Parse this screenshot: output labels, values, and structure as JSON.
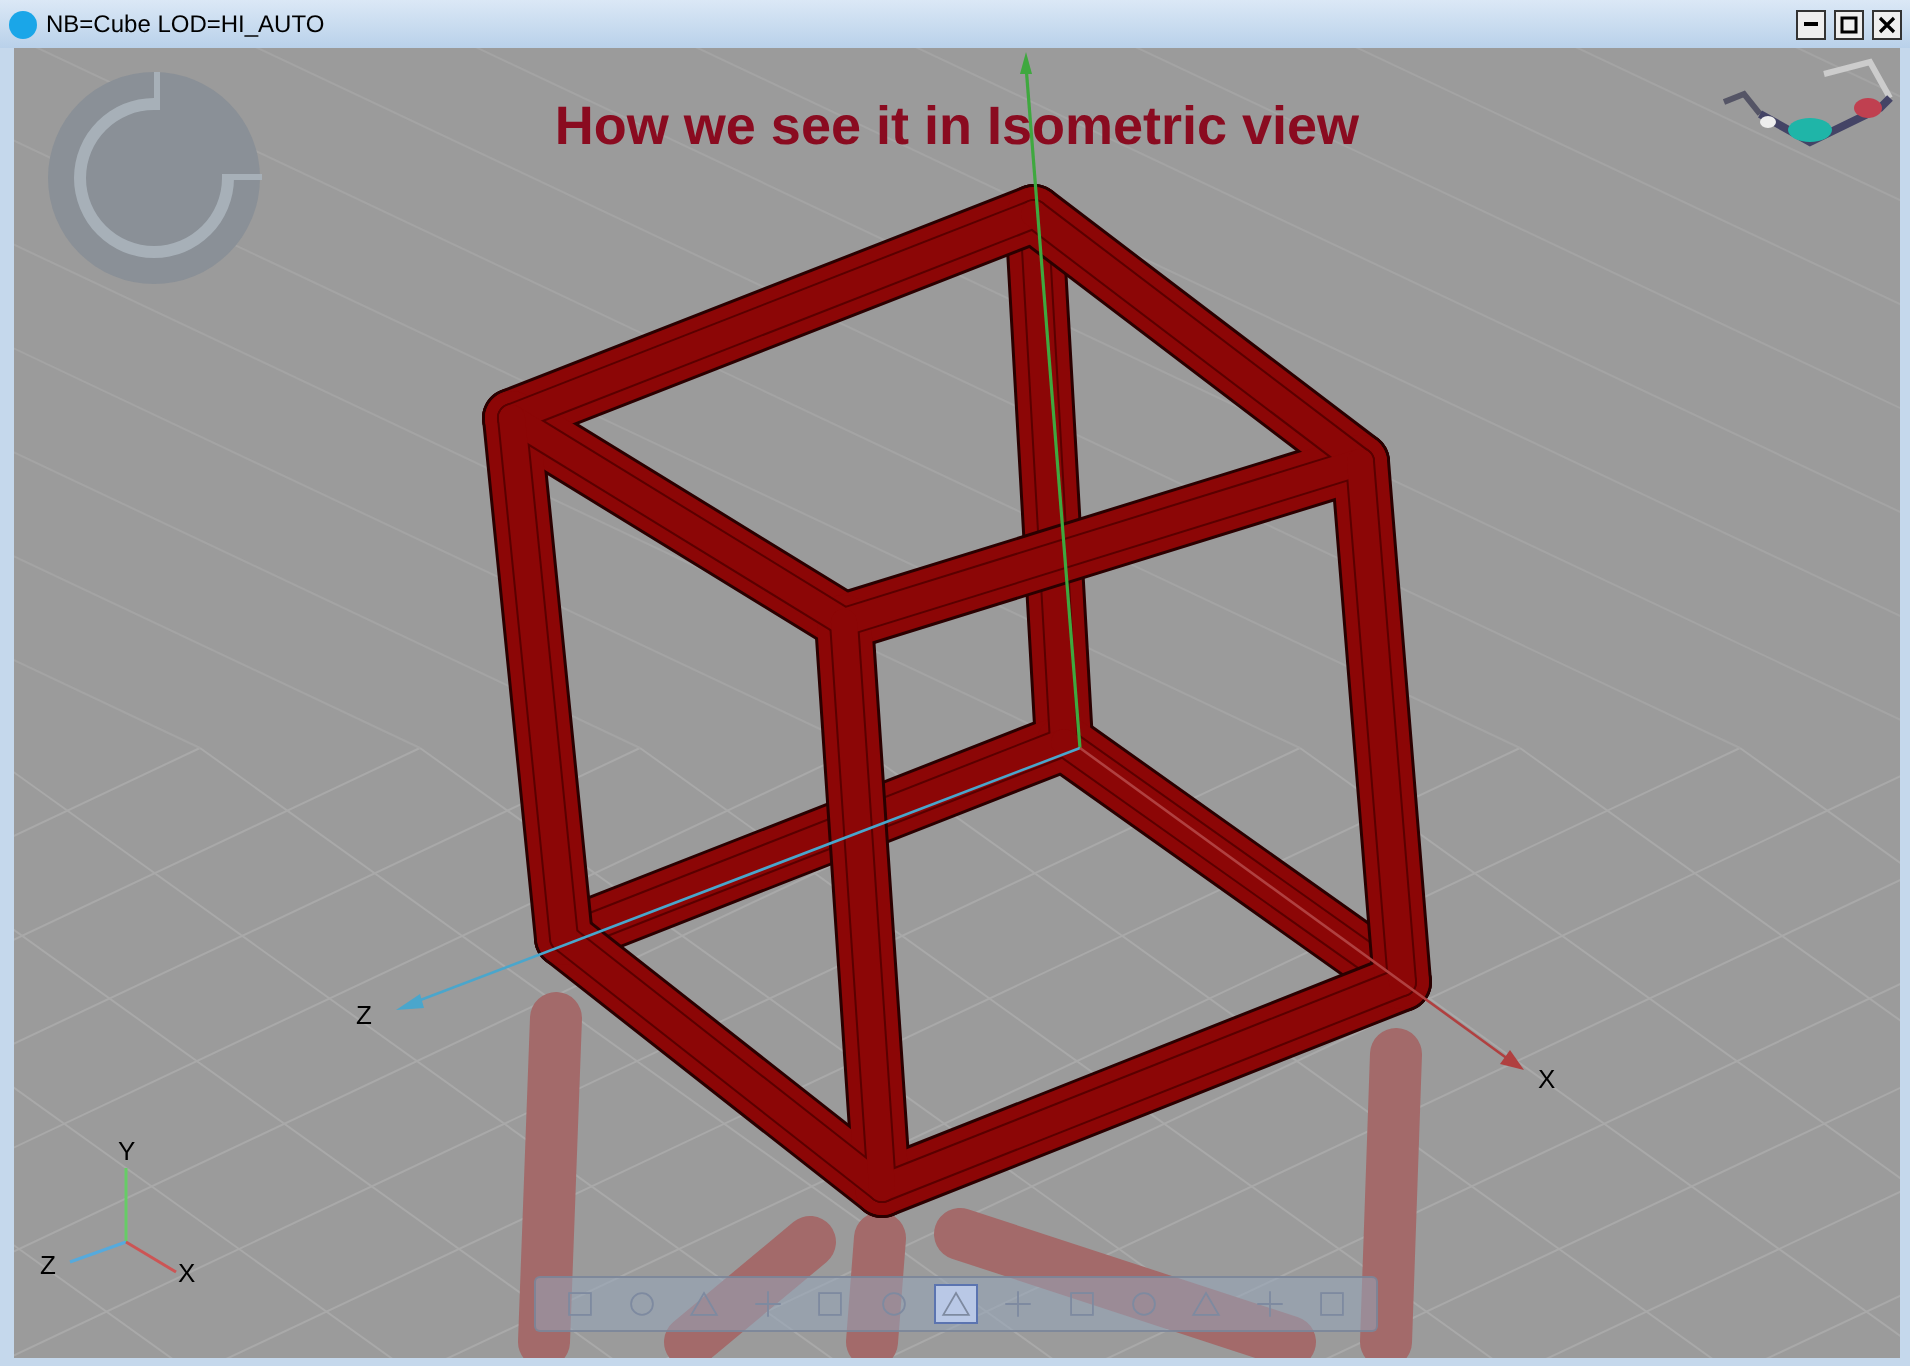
{
  "window": {
    "title": "NB=Cube LOD=HI_AUTO"
  },
  "viewport": {
    "heading": "How we see it in Isometric view",
    "scene_axes": [
      {
        "label": "Z"
      },
      {
        "label": "X"
      }
    ],
    "gizmo_axes": [
      {
        "label": "Y"
      },
      {
        "label": "Z"
      },
      {
        "label": "X"
      }
    ],
    "toolbar": [
      {
        "selected": false
      },
      {
        "selected": false
      },
      {
        "selected": false
      },
      {
        "selected": false
      },
      {
        "selected": false
      },
      {
        "selected": false
      },
      {
        "selected": true
      },
      {
        "selected": false
      },
      {
        "selected": false
      },
      {
        "selected": false
      },
      {
        "selected": false
      },
      {
        "selected": false
      },
      {
        "selected": false
      }
    ]
  }
}
